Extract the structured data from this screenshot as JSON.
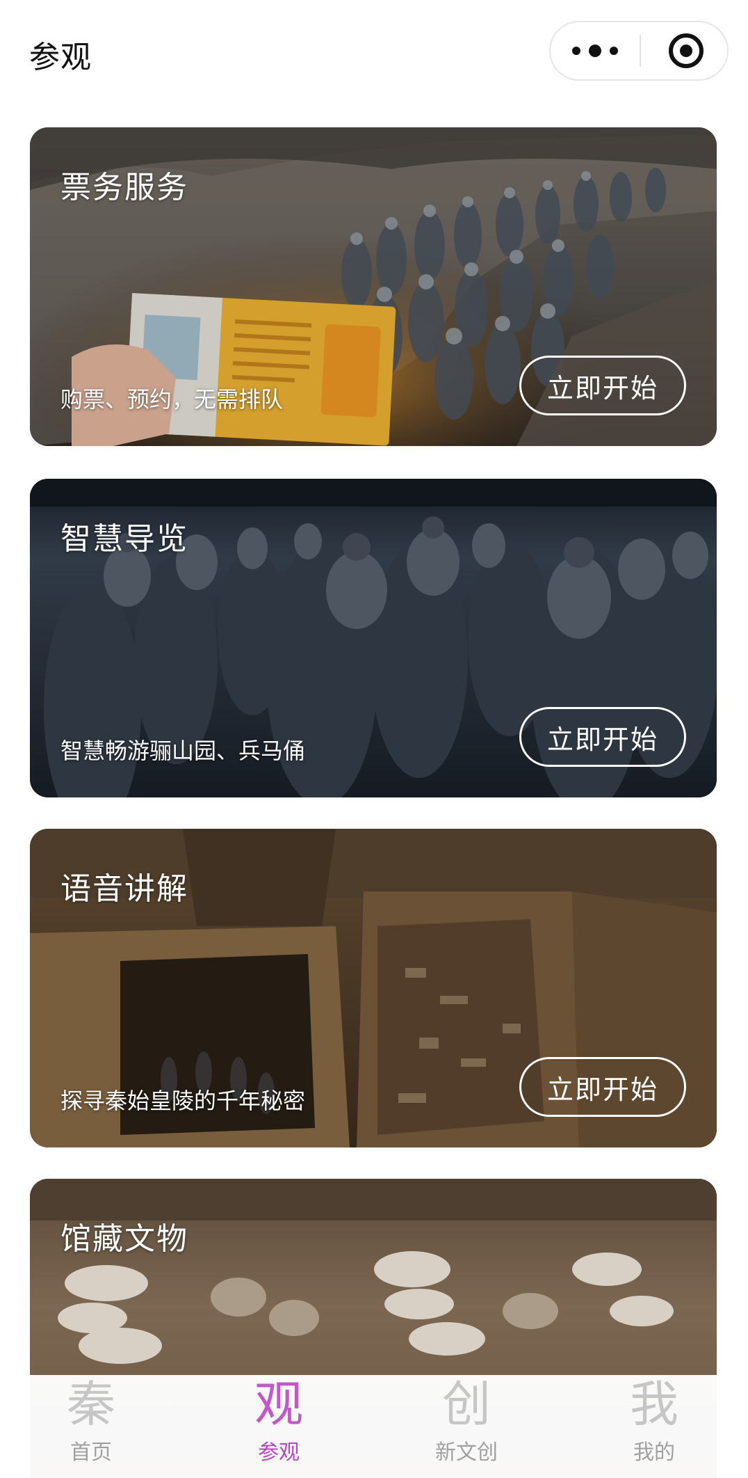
{
  "header": {
    "title": "参观",
    "more_icon": "more-dots-icon",
    "close_icon": "target-circle-icon"
  },
  "cards": [
    {
      "title": "票务服务",
      "subtitle": "购票、预约，无需排队",
      "button": "立即开始",
      "scene": "ticket-terracotta-pit-photo"
    },
    {
      "title": "智慧导览",
      "subtitle": "智慧畅游骊山园、兵马俑",
      "button": "立即开始",
      "scene": "terracotta-warriors-photo"
    },
    {
      "title": "语音讲解",
      "subtitle": "探寻秦始皇陵的千年秘密",
      "button": "立即开始",
      "scene": "excavation-pit-photo"
    },
    {
      "title": "馆藏文物",
      "subtitle": "",
      "button": "",
      "scene": "pottery-horses-photo"
    }
  ],
  "tabbar": {
    "active_color": "#b448c0",
    "items": [
      {
        "icon_char": "秦",
        "label": "首页"
      },
      {
        "icon_char": "观",
        "label": "参观"
      },
      {
        "icon_char": "创",
        "label": "新文创"
      },
      {
        "icon_char": "我",
        "label": "我的"
      }
    ]
  }
}
